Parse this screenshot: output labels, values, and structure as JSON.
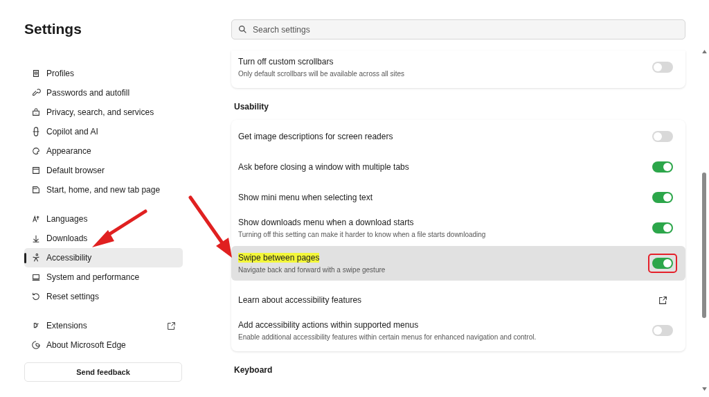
{
  "sidebar": {
    "title": "Settings",
    "groups": [
      {
        "items": [
          {
            "label": "Profiles",
            "selected": false
          },
          {
            "label": "Passwords and autofill",
            "selected": false
          },
          {
            "label": "Privacy, search, and services",
            "selected": false
          },
          {
            "label": "Copilot and AI",
            "selected": false
          },
          {
            "label": "Appearance",
            "selected": false
          },
          {
            "label": "Default browser",
            "selected": false
          },
          {
            "label": "Start, home, and new tab page",
            "selected": false
          }
        ]
      },
      {
        "items": [
          {
            "label": "Languages",
            "selected": false
          },
          {
            "label": "Downloads",
            "selected": false
          },
          {
            "label": "Accessibility",
            "selected": true
          },
          {
            "label": "System and performance",
            "selected": false
          },
          {
            "label": "Reset settings",
            "selected": false
          }
        ]
      },
      {
        "items": [
          {
            "label": "Extensions",
            "selected": false,
            "external": true
          },
          {
            "label": "About Microsoft Edge",
            "selected": false
          }
        ]
      }
    ],
    "feedback_button": "Send feedback"
  },
  "search": {
    "placeholder": "Search settings"
  },
  "sections": [
    {
      "cards": [
        {
          "rows": [
            {
              "kind": "toggle",
              "label": "Turn off custom scrollbars",
              "description": "Only default scrollbars will be available across all sites",
              "on": false,
              "highlighted": false,
              "outlined": false
            }
          ]
        }
      ]
    },
    {
      "heading": "Usability",
      "cards": [
        {
          "rows": [
            {
              "kind": "toggle",
              "label": "Get image descriptions for screen readers",
              "on": false,
              "highlighted": false,
              "outlined": false
            },
            {
              "kind": "toggle",
              "label": "Ask before closing a window with multiple tabs",
              "on": true,
              "highlighted": false,
              "outlined": false
            },
            {
              "kind": "toggle",
              "label": "Show mini menu when selecting text",
              "on": true,
              "highlighted": false,
              "outlined": false
            },
            {
              "kind": "toggle",
              "label": "Show downloads menu when a download starts",
              "description": "Turning off this setting can make it harder to know when a file starts downloading",
              "on": true,
              "highlighted": false,
              "outlined": false
            },
            {
              "kind": "toggle",
              "label": "Swipe between pages",
              "description": "Navigate back and forward with a swipe gesture",
              "on": true,
              "highlighted": true,
              "outlined": true
            },
            {
              "kind": "link",
              "label": "Learn about accessibility features",
              "highlighted": false
            },
            {
              "kind": "toggle",
              "label": "Add accessibility actions within supported menus",
              "description": "Enable additional accessibility features within certain menus for enhanced navigation and control.",
              "on": false,
              "highlighted": false,
              "outlined": false
            }
          ]
        }
      ]
    },
    {
      "heading": "Keyboard"
    }
  ]
}
